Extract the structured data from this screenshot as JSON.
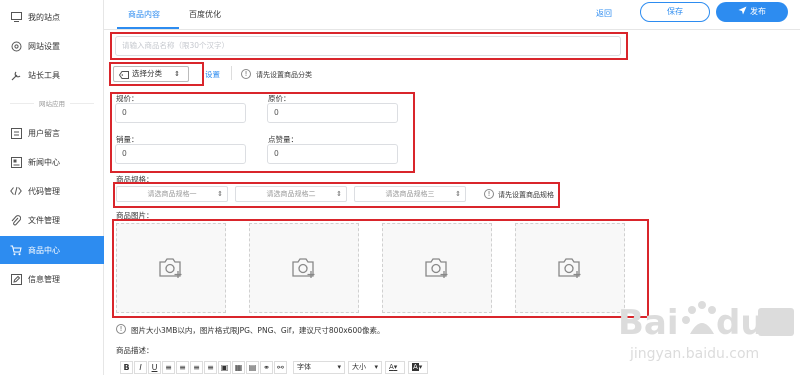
{
  "sidebar": {
    "items": [
      {
        "label": "我的站点",
        "icon": "monitor-icon"
      },
      {
        "label": "网站设置",
        "icon": "settings-circle-icon"
      },
      {
        "label": "站长工具",
        "icon": "tools-icon"
      },
      {
        "label": "用户留言",
        "icon": "message-icon"
      },
      {
        "label": "新闻中心",
        "icon": "news-icon"
      },
      {
        "label": "代码管理",
        "icon": "code-icon"
      },
      {
        "label": "文件管理",
        "icon": "paperclip-icon"
      },
      {
        "label": "商品中心",
        "icon": "cart-icon"
      },
      {
        "label": "信息管理",
        "icon": "edit-icon"
      }
    ],
    "group_label": "网站应用",
    "active_color": "#2d8cf0"
  },
  "header": {
    "tabs": [
      "商品内容",
      "百度优化"
    ],
    "back_label": "返回",
    "save_label": "保存",
    "publish_label": "发布"
  },
  "form": {
    "name_placeholder": "请输入商品名称（限30个汉字）",
    "category_select": "选择分类",
    "category_setting": "设置",
    "category_hint": "请先设置商品分类",
    "spec_price_label": "规价：",
    "spec_price_value": "0",
    "original_price_label": "原价：",
    "original_price_value": "0",
    "sales_label": "销量：",
    "sales_value": "0",
    "likes_label": "点赞量：",
    "likes_value": "0",
    "spec_label": "商品规格：",
    "spec_options": [
      "请选商品规格一",
      "请选商品规格二",
      "请选商品规格三"
    ],
    "spec_hint": "请先设置商品规格",
    "images_label": "商品图片：",
    "images_note": "图片大小3MB以内，图片格式限JPG、PNG、Gif，建议尺寸800x600像素。",
    "desc_label": "商品描述：",
    "toolbar": {
      "buttons": [
        "B",
        "I",
        "U",
        "≡",
        "≡",
        "≡",
        "≡",
        "▣",
        "▦",
        "▤",
        "⚭",
        "⚯"
      ],
      "font_label": "字体",
      "size_label": "大小",
      "color_label": "A",
      "bg_label": "A"
    }
  },
  "accent_color": "#2d8cf0",
  "highlight_color": "#d9252b"
}
